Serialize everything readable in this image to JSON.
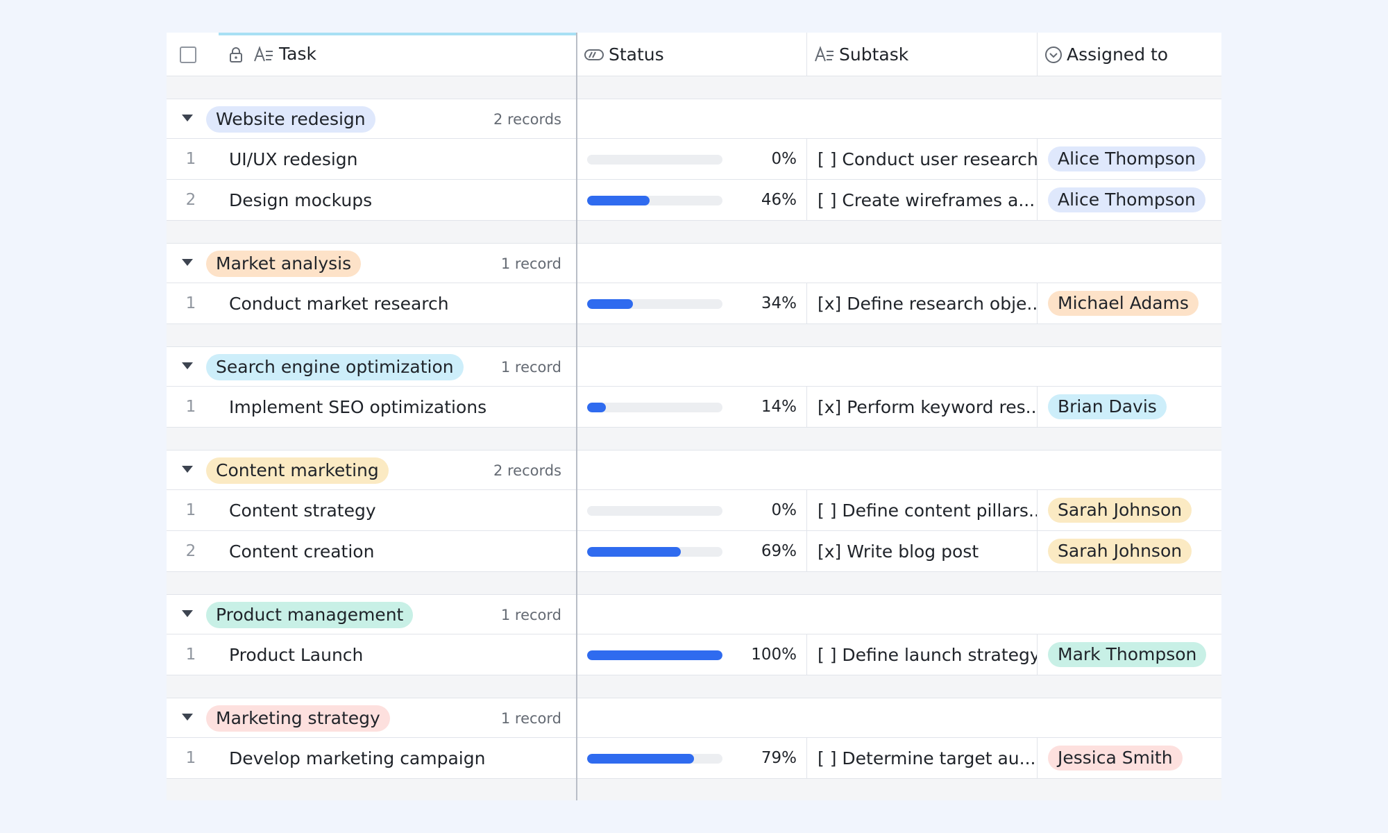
{
  "header": {
    "task": "Task",
    "status": "Status",
    "subtask": "Subtask",
    "assigned": "Assigned to"
  },
  "groups": [
    {
      "name": "Website redesign",
      "color": "#dfe8fc",
      "count": "2 records",
      "rows": [
        {
          "idx": "1",
          "task": "UI/UX redesign",
          "progress": 0,
          "pct": "0%",
          "subtask": "[ ] Conduct user research",
          "assignee": "Alice Thompson"
        },
        {
          "idx": "2",
          "task": "Design mockups",
          "progress": 46,
          "pct": "46%",
          "subtask": "[ ] Create wireframes a...",
          "assignee": "Alice Thompson"
        }
      ]
    },
    {
      "name": "Market analysis",
      "color": "#fde2c8",
      "count": "1 record",
      "rows": [
        {
          "idx": "1",
          "task": "Conduct market research",
          "progress": 34,
          "pct": "34%",
          "subtask": "[x] Define research obje...",
          "assignee": "Michael Adams"
        }
      ]
    },
    {
      "name": "Search engine optimization",
      "color": "#cdeefa",
      "count": "1 record",
      "rows": [
        {
          "idx": "1",
          "task": "Implement SEO optimizations",
          "progress": 14,
          "pct": "14%",
          "subtask": "[x] Perform keyword res...",
          "assignee": "Brian Davis"
        }
      ]
    },
    {
      "name": "Content marketing",
      "color": "#fbeac3",
      "count": "2 records",
      "rows": [
        {
          "idx": "1",
          "task": "Content strategy",
          "progress": 0,
          "pct": "0%",
          "subtask": "[ ] Define content pillars...",
          "assignee": "Sarah Johnson"
        },
        {
          "idx": "2",
          "task": "Content creation",
          "progress": 69,
          "pct": "69%",
          "subtask": "[x] Write blog post",
          "assignee": "Sarah Johnson"
        }
      ]
    },
    {
      "name": "Product management",
      "color": "#c8f0e6",
      "count": "1 record",
      "rows": [
        {
          "idx": "1",
          "task": "Product Launch",
          "progress": 100,
          "pct": "100%",
          "subtask": "[ ] Define launch strategy",
          "assignee": "Mark Thompson"
        }
      ]
    },
    {
      "name": "Marketing strategy",
      "color": "#fde0de",
      "count": "1 record",
      "rows": [
        {
          "idx": "1",
          "task": "Develop marketing campaign",
          "progress": 79,
          "pct": "79%",
          "subtask": "[ ] Determine target au...",
          "assignee": "Jessica Smith"
        }
      ]
    }
  ]
}
